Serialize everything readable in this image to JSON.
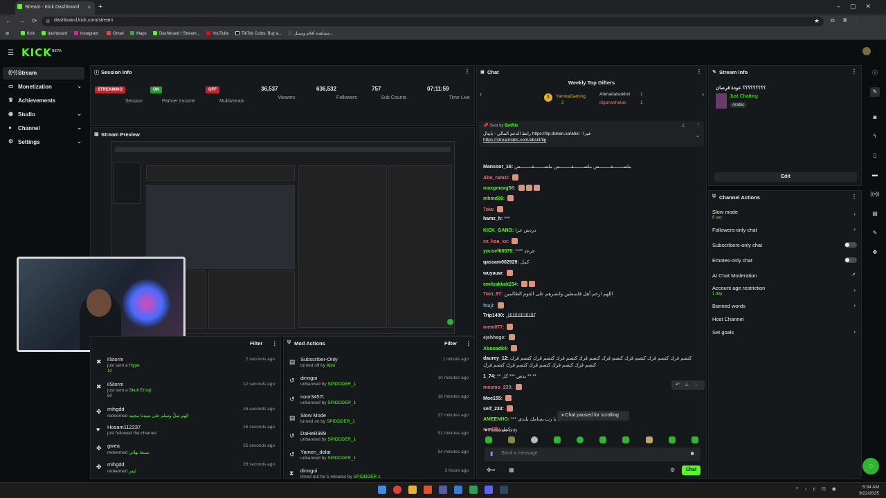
{
  "browser": {
    "tab_title": "Stream - Kick Dashboard",
    "url": "dashboard.kick.com/stream",
    "bookmarks": [
      "Kick",
      "dashboard",
      "instagram",
      "Gmail",
      "Maps",
      "Dashboard / Stream...",
      "YouTube",
      "TikTok Coins: Buy a...",
      "مشاهدة أفلام ومسل..."
    ]
  },
  "brand": {
    "logo": "KICK",
    "logo_sup": "BETA",
    "accent": "#53fc18"
  },
  "sidebar": {
    "items": [
      {
        "label": "Stream",
        "icon": "broadcast-icon"
      },
      {
        "label": "Monetization",
        "icon": "money-icon"
      },
      {
        "label": "Achievements",
        "icon": "trophy-icon"
      },
      {
        "label": "Studio",
        "icon": "studio-icon"
      },
      {
        "label": "Channel",
        "icon": "user-icon"
      },
      {
        "label": "Settings",
        "icon": "gear-icon"
      }
    ]
  },
  "session": {
    "title": "Session Info",
    "stats": [
      {
        "badge": "STREAMING",
        "label": "Session"
      },
      {
        "badge": "ON",
        "label": "Partner Income"
      },
      {
        "badge": "OFF",
        "label": "Multistream"
      },
      {
        "value": "36,537",
        "label": "Viewers"
      },
      {
        "value": "636,532",
        "label": "Followers"
      },
      {
        "value": "757",
        "label": "Sub Counts"
      },
      {
        "value": "07:11:59",
        "label": "Time Live"
      }
    ]
  },
  "preview": {
    "title": "Stream Preview"
  },
  "activity": {
    "filter": "Filter",
    "items": [
      {
        "name": "ilStorm",
        "desc": "just sent a",
        "hl": "Hype",
        "time": "2 seconds ago",
        "extra": "10"
      },
      {
        "name": "ilStorm",
        "desc": "just sent a",
        "hl": "Skull Emoji",
        "time": "12 seconds ago",
        "extra": "50"
      },
      {
        "name": "mihgdd",
        "desc": "redeemed",
        "hl": "الهم صلّ وسلم على سيدنا محمد",
        "time": "16 seconds ago",
        "extra": ""
      },
      {
        "name": "Hosam112237",
        "desc": "just followed the channel",
        "hl": "",
        "time": "16 seconds ago",
        "extra": ""
      },
      {
        "name": "gwea",
        "desc": "redeemed",
        "hl": "بسط نهائي",
        "time": "25 seconds ago",
        "extra": ""
      },
      {
        "name": "mihgdd",
        "desc": "redeemed",
        "hl": "ليقر",
        "time": "28 seconds ago",
        "extra": ""
      }
    ]
  },
  "mod_actions": {
    "title": "Mod Actions",
    "filter": "Filter",
    "items": [
      {
        "name": "Subscriber-Only",
        "desc": "turned off by",
        "by": "Absi",
        "time": "1 minute ago"
      },
      {
        "name": "dinngoi",
        "desc": "unbanned by",
        "by": "SPIDDDER_1",
        "time": "10 minutes ago"
      },
      {
        "name": "noor3457t",
        "desc": "unbanned by",
        "by": "SPIDDDER_1",
        "time": "16 minutes ago"
      },
      {
        "name": "Slow Mode",
        "desc": "turned on by",
        "by": "SPIDDDER_1",
        "time": "37 minutes ago"
      },
      {
        "name": "DaHeR999",
        "desc": "unbanned by",
        "by": "SPIDDDER_1",
        "time": "51 minutes ago"
      },
      {
        "name": "Yamen_dolat",
        "desc": "unbanned by",
        "by": "SPIDDDER_1",
        "time": "54 minutes ago"
      },
      {
        "name": "dinngoi",
        "desc": "timed out for 5 minutes by",
        "by": "SPIDDDER 1",
        "time": "2 hours ago"
      }
    ]
  },
  "chat": {
    "title": "Chat",
    "gifters_title": "Weekly Top Gifters",
    "gifters": [
      {
        "name": "YamnaGaming",
        "count": "2"
      },
      {
        "name": "Ahmadalsokhni",
        "count": "1"
      },
      {
        "name": "diganashalab",
        "count": "1"
      }
    ],
    "pinned": {
      "sent_by": "Sent by",
      "bot": "BotRix",
      "text": "رابط الدعم المالي - بايبال https://tip.dokan.sa/absi - فيزا",
      "link": "https://streamlabs.com/absi4/tip"
    },
    "messages": [
      {
        "user": "Mansoor_16:",
        "text": "ملصـــــــقــــــــص ملصـــــــقــــــــص ملصـــــــقــــــــص",
        "color": "#eee",
        "emo": 0
      },
      {
        "user": "Abo_ramzi:",
        "text": "",
        "color": "#ff6b6b",
        "emo": 1
      },
      {
        "user": "maxgmaxg56:",
        "text": "",
        "color": "#53fc18",
        "emo": 3
      },
      {
        "user": "mhmd06:",
        "text": "",
        "color": "#53fc18",
        "emo": 1
      },
      {
        "user": "7oia:",
        "text": "",
        "color": "#ff6b6b",
        "emo": 1
      },
      {
        "user": "hamz_h:",
        "text": "***",
        "color": "#eee",
        "emo": 0
      },
      {
        "user": "KICK_GANO:",
        "text": "دردش خرا",
        "color": "#53fc18",
        "emo": 0
      },
      {
        "user": "xx_ksa_xx:",
        "text": "",
        "color": "#ff6b6b",
        "emo": 1
      },
      {
        "user": "yousef66579:",
        "text": "**** عرعد",
        "color": "#53fc18",
        "emo": 0
      },
      {
        "user": "qassam002929:",
        "text": "كمل",
        "color": "#eee",
        "emo": 0
      },
      {
        "user": "wuyauw:",
        "text": "",
        "color": "#eee",
        "emo": 1
      },
      {
        "user": "emilzakkak234:",
        "text": "",
        "color": "#53fc18",
        "emo": 2
      },
      {
        "user": "7mn_97:",
        "text": "اللهم ارحم أهل فلسطين وانصرهم على القوم الظالمين",
        "color": "#ff6b6b",
        "emo": 0
      },
      {
        "user": "fsuji:",
        "text": "",
        "color": "#5aa9ff",
        "emo": 1
      },
      {
        "user": "Trip1400:",
        "text": "كلللللللللللللللل",
        "color": "#eee",
        "emo": 0
      },
      {
        "user": "mem077:",
        "text": "",
        "color": "#ff6b6b",
        "emo": 1
      },
      {
        "user": "ejehhege:",
        "text": "",
        "color": "#bbb",
        "emo": 1
      },
      {
        "user": "Abooad84:",
        "text": "",
        "color": "#53fc18",
        "emo": 1
      },
      {
        "user": "daurey_12:",
        "text": "كتصم قرك كتصم قرك كتصم قرك كتصم قرك كتصم قرك كتصم قرك كتصم قرك كتصم قرك",
        "color": "#eee",
        "emo": 0
      },
      {
        "user": "",
        "text": "كتصم قرك كتصم قرك كتصم قرك كتصم قرك كتصم قرك",
        "color": "#eee",
        "emo": 0
      },
      {
        "user": "1_74:",
        "text": "** بدص *** كل ** **",
        "color": "#eee",
        "emo": 0
      },
      {
        "user": "mosmo_233:",
        "text": "",
        "color": "#ff6b6b",
        "emo": 1
      },
      {
        "user": "Moe155:",
        "text": "",
        "color": "#eee",
        "emo": 1
      },
      {
        "user": "seif_233:",
        "text": "",
        "color": "#eee",
        "emo": 1
      },
      {
        "user": "AMEENHO:",
        "text": "*** جادك يا رب يسامك بلندي",
        "color": "#53fc18",
        "emo": 0
      },
      {
        "user": "mo475:",
        "text": "كمل",
        "color": "#ff6b6b",
        "emo": 0
      }
    ],
    "paused": "Chat paused for scrolling",
    "followers_only": "Followers only",
    "input_placeholder": "Send a message",
    "send_label": "Chat"
  },
  "stream_info": {
    "title": "Stream info",
    "stream_title": "؟؟؟؟؟؟؟؟؟ عودة قرصان",
    "category": "Just Chatting",
    "tag": "Arabic",
    "edit": "Edit"
  },
  "channel_actions": {
    "title": "Channel Actions",
    "items": [
      {
        "label": "Slow mode",
        "sub": "6 sec",
        "kind": "chevron"
      },
      {
        "label": "Followers-only chat",
        "sub": "",
        "kind": "chevron"
      },
      {
        "label": "Subscribers-only chat",
        "sub": "",
        "kind": "toggle"
      },
      {
        "label": "Emotes-only chat",
        "sub": "",
        "kind": "toggle"
      },
      {
        "label": "AI Chat Moderation",
        "sub": "",
        "kind": "external"
      },
      {
        "label": "Account age restriction",
        "sub": "1 day",
        "kind": "chevron"
      },
      {
        "label": "Banned words",
        "sub": "",
        "kind": "chevron"
      },
      {
        "label": "Host Channel",
        "sub": "",
        "kind": "none"
      },
      {
        "label": "Set goals",
        "sub": "",
        "kind": "chevron"
      }
    ]
  },
  "taskbar": {
    "time": "5:34 AM",
    "date": "9/22/2025"
  }
}
